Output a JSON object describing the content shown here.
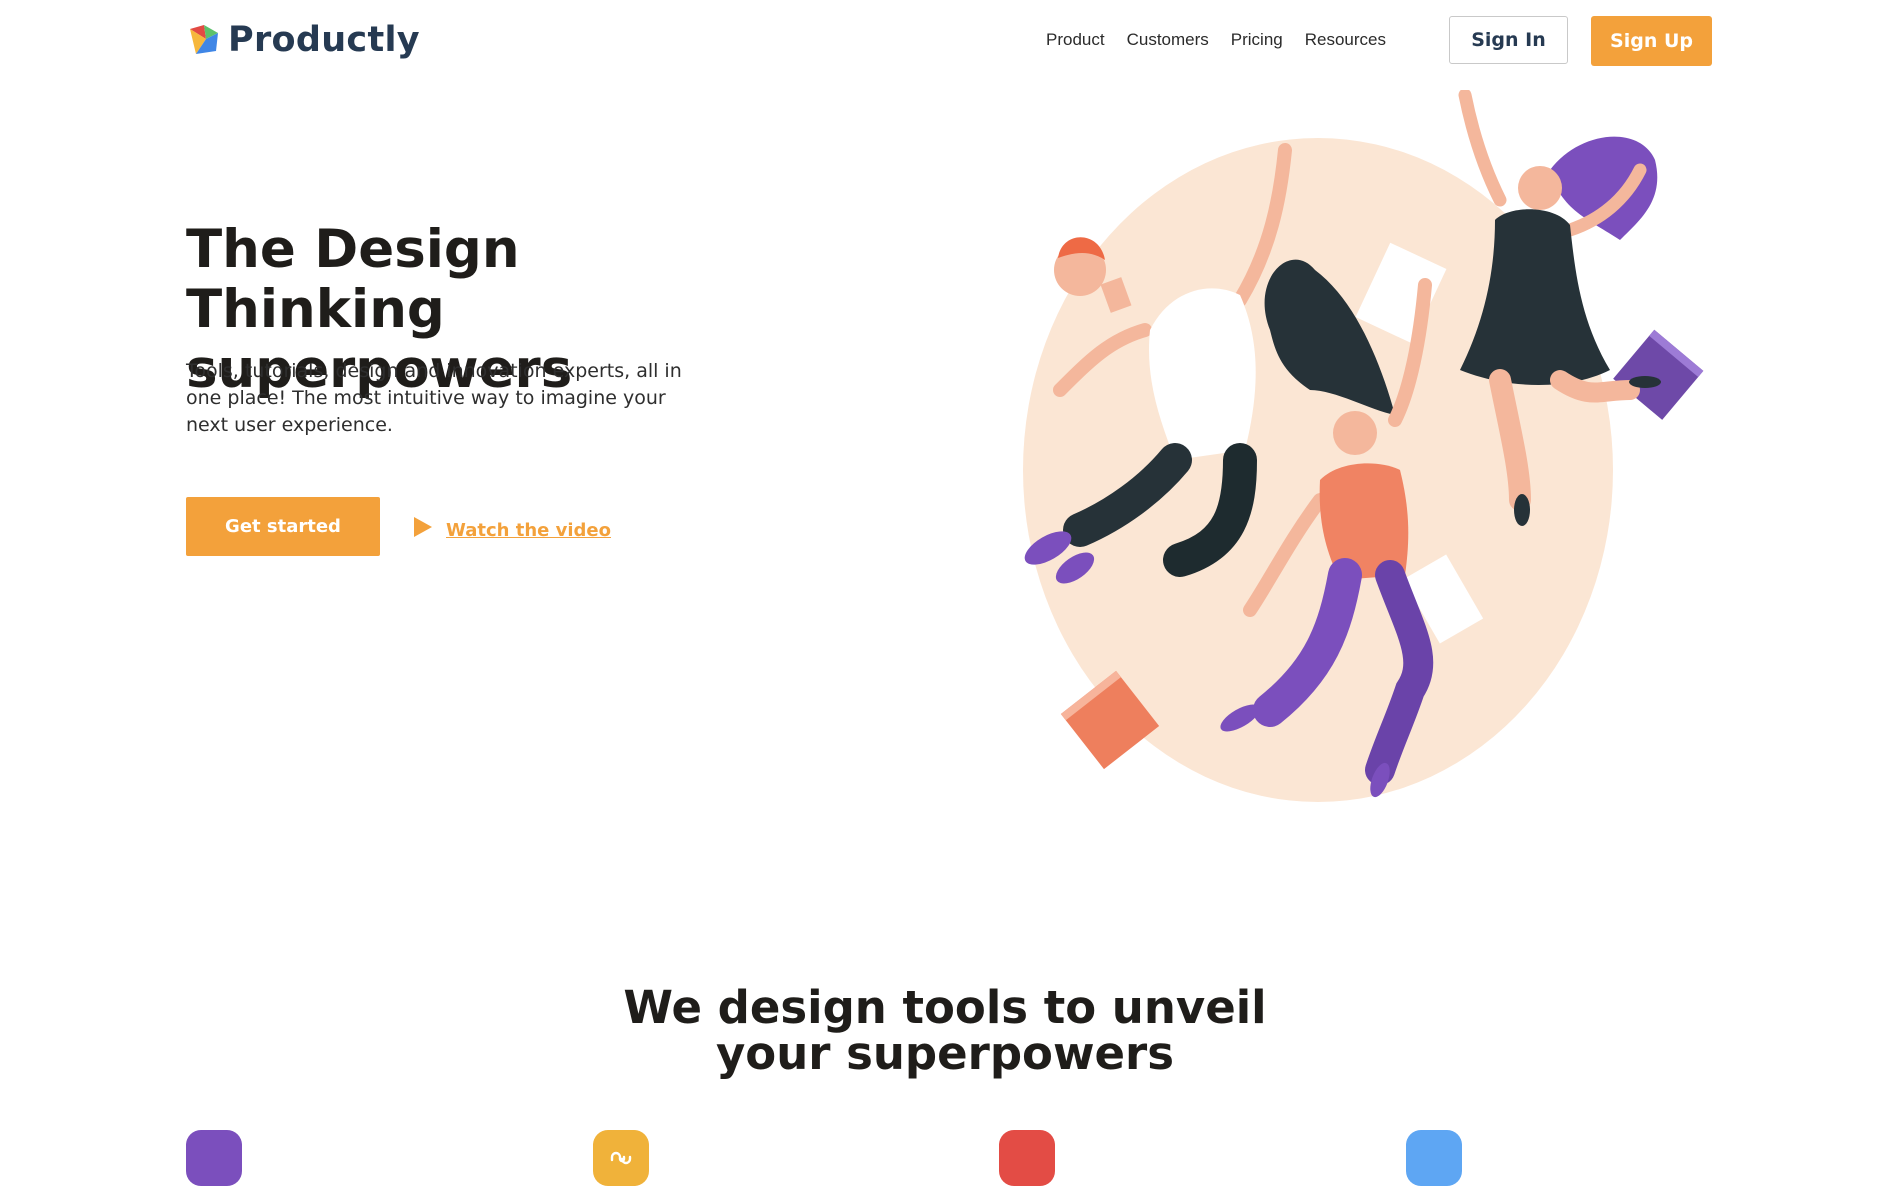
{
  "header": {
    "brand": "Productly",
    "nav": [
      "Product",
      "Customers",
      "Pricing",
      "Resources"
    ],
    "sign_in": "Sign In",
    "sign_up": "Sign Up"
  },
  "hero": {
    "title_line1": "The Design Thinking",
    "title_line2": "superpowers",
    "description": "Tools, tutorials, design and innovation experts, all in one place! The most intuitive way to imagine your next user experience.",
    "cta_primary": "Get started",
    "cta_video": "Watch the video"
  },
  "features": {
    "title_line1": "We design tools to unveil",
    "title_line2": "your superpowers",
    "icons": [
      {
        "name": "purple-feature-icon",
        "color": "#7b4fbd"
      },
      {
        "name": "yellow-feature-icon",
        "color": "#f0b23a"
      },
      {
        "name": "red-feature-icon",
        "color": "#e34c45"
      },
      {
        "name": "blue-feature-icon",
        "color": "#5ea6f3"
      }
    ]
  },
  "colors": {
    "accent": "#f3a13b",
    "brand_text": "#263a52",
    "illustration_blob": "#fbe6d4"
  }
}
